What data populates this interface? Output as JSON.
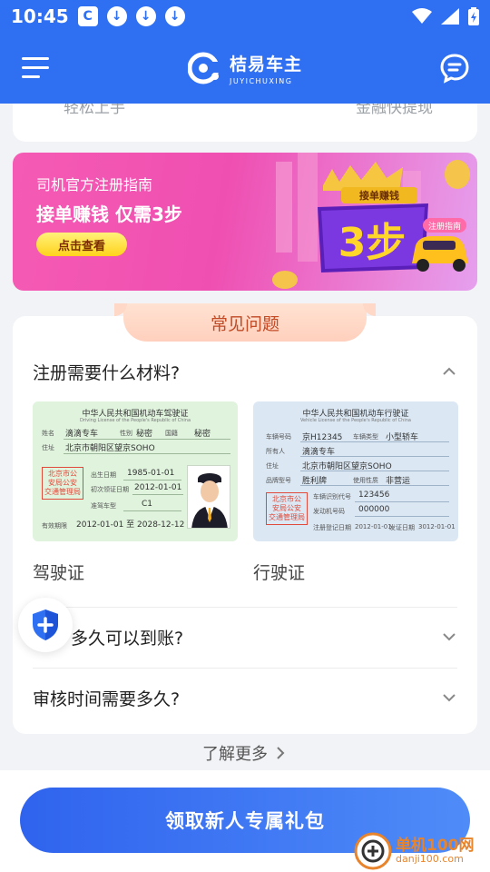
{
  "status_bar": {
    "time": "10:45",
    "notif_icons": [
      "app-icon",
      "download-icon",
      "download-icon",
      "download-icon"
    ]
  },
  "app_bar": {
    "brand_cn": "桔易车主",
    "brand_en": "JUYICHUXING"
  },
  "top_card": {
    "left_text": "轻松上手",
    "right_text": "金融快提现"
  },
  "banner": {
    "subtitle": "司机官方注册指南",
    "title": "接单赚钱 仅需3步",
    "button": "点击查看",
    "art_badge": "接单赚钱",
    "art_big": "3步",
    "art_tag": "注册指南"
  },
  "faq": {
    "header": "常见问题",
    "q1": "注册需要什么材料?",
    "q2": "多久可以到账?",
    "q3": "审核时间需要多久?",
    "driver_license": {
      "caption": "驾驶证",
      "title": "中华人民共和国机动车驾驶证",
      "subtitle": "Driving License of the People's Republic of China",
      "name_label": "姓名",
      "name": "滴滴专车",
      "sex_label": "性别",
      "sex": "秘密",
      "nation_label": "国籍",
      "nation": "秘密",
      "addr_label": "住址",
      "addr": "北京市朝阳区望京SOHO",
      "birth_label": "出生日期",
      "birth": "1985-01-01",
      "issue_label": "初次领证日期",
      "issue": "2012-01-01",
      "class_label": "准驾车型",
      "class": "C1",
      "valid_label": "有效期限",
      "valid": "2012-01-01 至 2028-12-12",
      "stamp": "北京市公\n安局公安\n交通管理局"
    },
    "vehicle_license": {
      "caption": "行驶证",
      "title": "中华人民共和国机动车行驶证",
      "subtitle": "Vehicle License of the People's Republic of China",
      "plate_label": "车辆号码",
      "plate": "京H12345",
      "type_label": "车辆类型",
      "type": "小型轿车",
      "owner_label": "所有人",
      "owner": "滴滴专车",
      "addr_label": "住址",
      "addr": "北京市朝阳区望京SOHO",
      "model_label": "品牌型号",
      "model": "胜利牌",
      "use_label": "使用性质",
      "use": "非营运",
      "vin_label": "车辆识别代号",
      "vin": "123456",
      "engine_label": "发动机号码",
      "engine": "000000",
      "reg_label": "注册登记日期",
      "reg": "2012-01-01",
      "issue_label": "发证日期",
      "issue": "3012-01-01",
      "stamp": "北京市公\n安局公安\n交通管理局"
    }
  },
  "more_link": "了解更多",
  "cta": "领取新人专属礼包",
  "watermark": {
    "cn": "单机100网",
    "en": "danji100.com"
  },
  "colors": {
    "primary": "#2f6ff2",
    "banner_pink": "#ef4fb1",
    "faq_accent": "#c24a25",
    "watermark": "#e8842c"
  }
}
